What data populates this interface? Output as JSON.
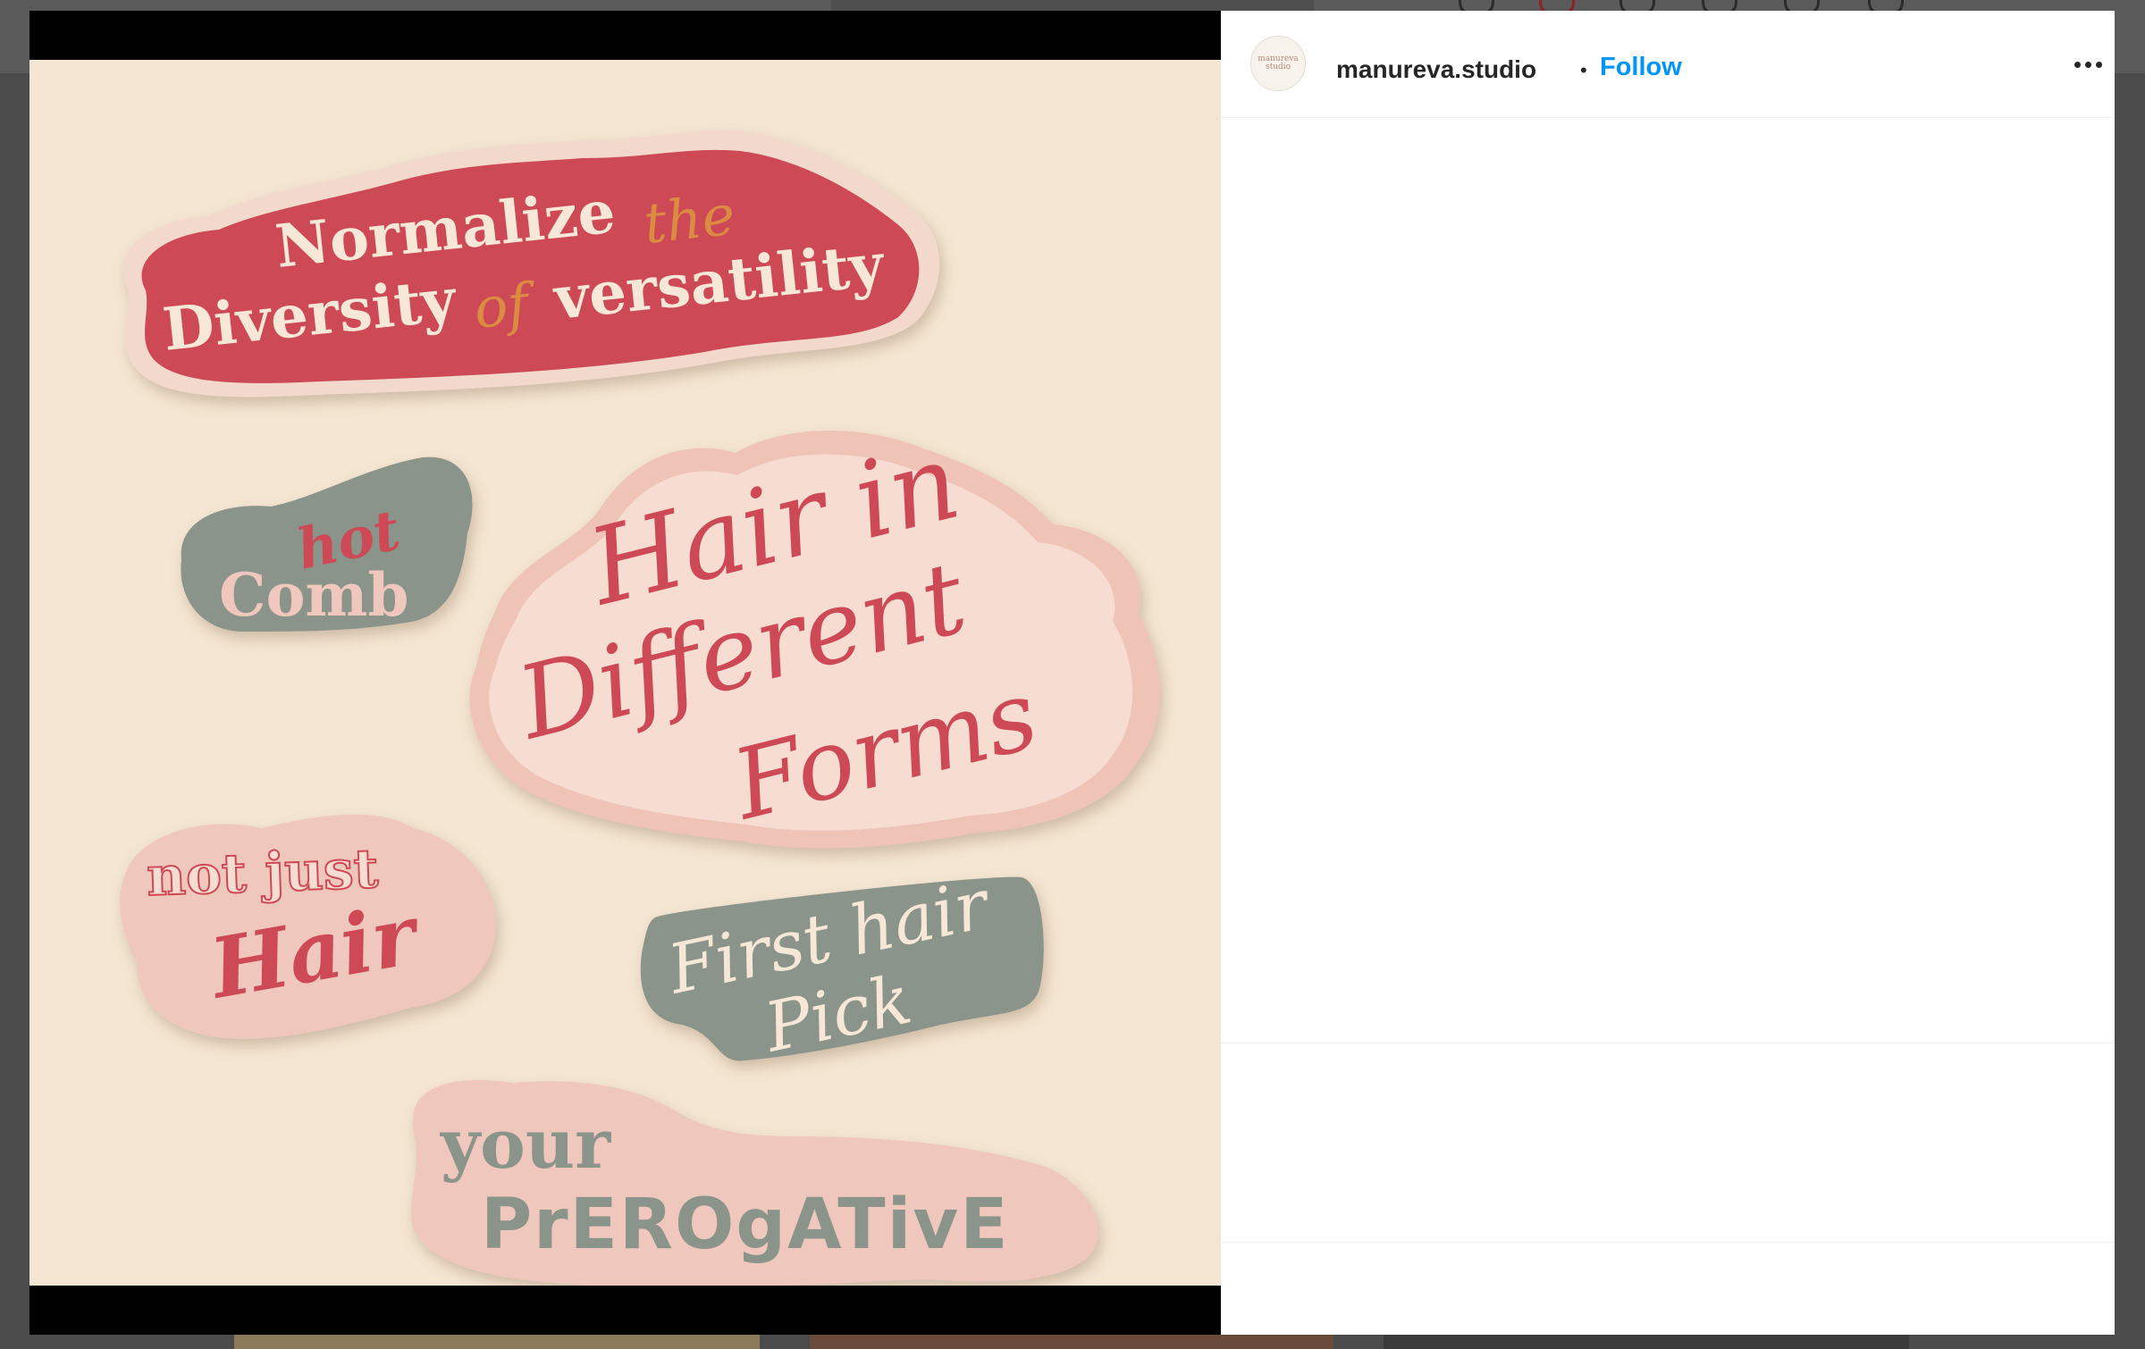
{
  "post": {
    "username": "manureva.studio",
    "separator": "•",
    "follow_label": "Follow",
    "avatar_text_line1": "manureva",
    "avatar_text_line2": "studio",
    "more_icon": "more-horizontal-icon"
  },
  "image": {
    "stickers": {
      "s1_line1": "Normalize",
      "s1_the": "the",
      "s1_diversity": "Diversity",
      "s1_of": "of",
      "s1_versatility": "versatility",
      "s2_hot": "hot",
      "s2_comb": "Comb",
      "s3_line1": "Hair in",
      "s3_line2": "Different",
      "s3_line3": "Forms",
      "s4_line1": "not just",
      "s4_line2": "Hair",
      "s5_line1": "First hair",
      "s5_line2": "Pick",
      "s6_line1": "your",
      "s6_line2": "PrEROgATivE"
    },
    "colors": {
      "background": "#f4e6d2",
      "red": "#cc4a55",
      "pink": "#e8b7ae",
      "sage": "#8a948a",
      "orange": "#dc8c42",
      "cream": "#f6e7d6"
    }
  }
}
